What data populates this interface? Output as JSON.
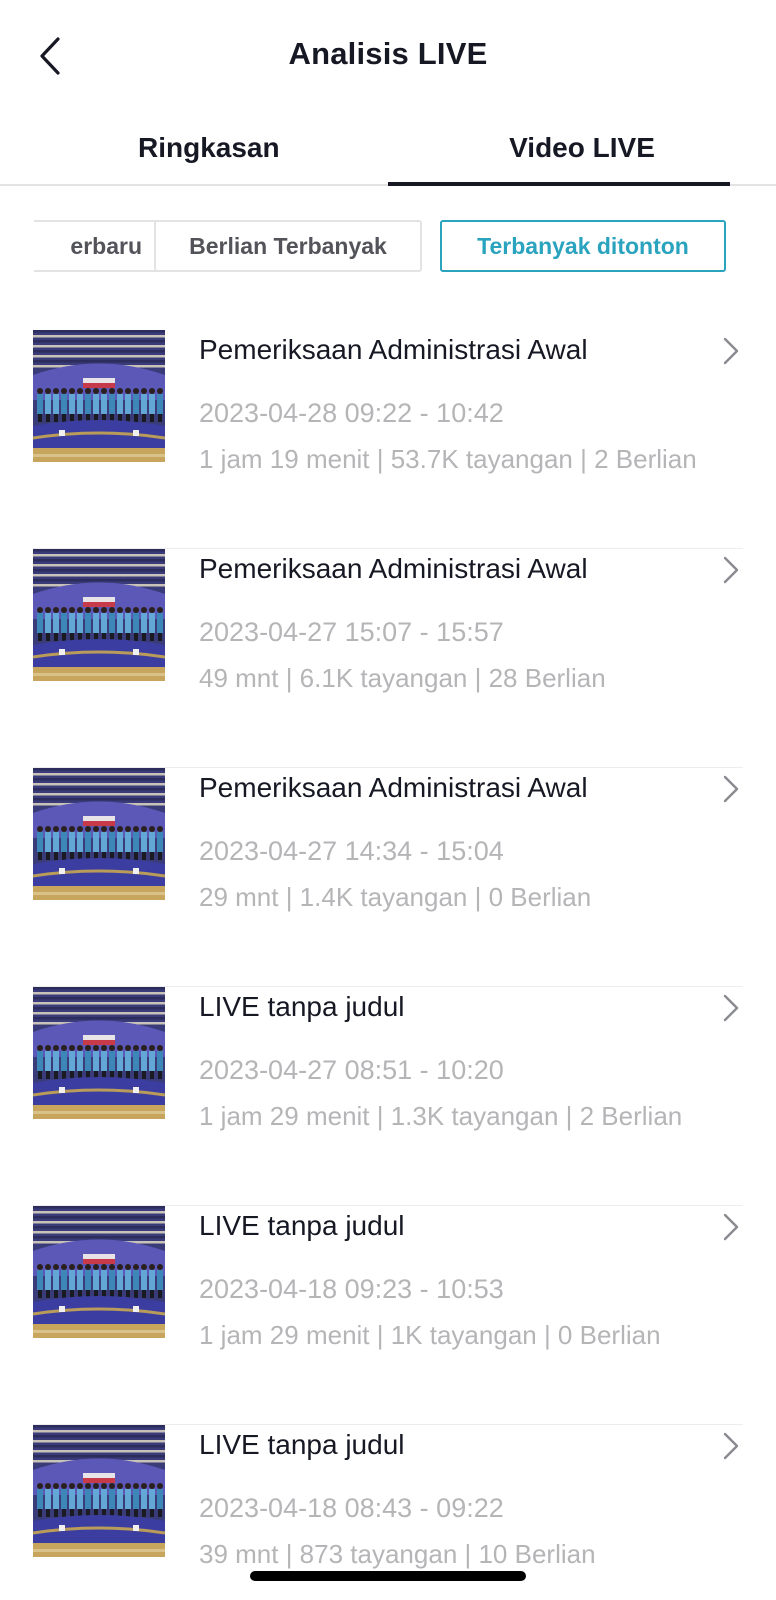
{
  "header": {
    "title": "Analisis LIVE",
    "back_icon": "chevron-left-icon"
  },
  "tabs": [
    {
      "label": "Ringkasan",
      "active": false
    },
    {
      "label": "Video LIVE",
      "active": true
    }
  ],
  "filters": [
    {
      "label": "erbaru",
      "active": false
    },
    {
      "label": "Berlian Terbanyak",
      "active": false
    },
    {
      "label": "Terbanyak ditonton",
      "active": true
    }
  ],
  "colors": {
    "accent": "#2aa3be",
    "text_primary": "#161823",
    "text_secondary": "#b5b5b8",
    "divider": "#ededee"
  },
  "videos": [
    {
      "title": "Pemeriksaan Administrasi Awal",
      "date": "2023-04-28 09:22 - 10:42",
      "stats": "1 jam 19 menit | 53.7K tayangan | 2 Berlian"
    },
    {
      "title": "Pemeriksaan Administrasi Awal",
      "date": "2023-04-27 15:07 - 15:57",
      "stats": "49 mnt | 6.1K tayangan | 28 Berlian"
    },
    {
      "title": "Pemeriksaan Administrasi Awal",
      "date": "2023-04-27 14:34 - 15:04",
      "stats": "29 mnt | 1.4K tayangan | 0 Berlian"
    },
    {
      "title": "LIVE tanpa judul",
      "date": "2023-04-27 08:51 - 10:20",
      "stats": "1 jam 29 menit | 1.3K tayangan | 2 Berlian"
    },
    {
      "title": "LIVE tanpa judul",
      "date": "2023-04-18 09:23 - 10:53",
      "stats": "1 jam 29 menit | 1K tayangan | 0 Berlian"
    },
    {
      "title": "LIVE tanpa judul",
      "date": "2023-04-18 08:43 - 09:22",
      "stats": "39 mnt | 873 tayangan | 10 Berlian"
    }
  ]
}
